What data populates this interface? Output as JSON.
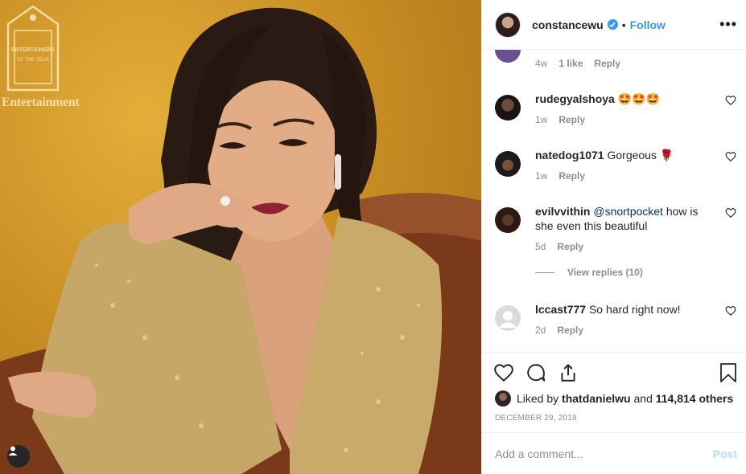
{
  "photo": {
    "brand": "Entertainment",
    "badge_text": "ENTERTAINERS OF THE YEAR",
    "tag_icon": "user-tag-icon"
  },
  "header": {
    "username": "constancewu",
    "verified_icon": "verified-badge-icon",
    "separator": "•",
    "follow_label": "Follow",
    "more_label": "•••"
  },
  "partial_comment": {
    "time": "4w",
    "likes": "1 like",
    "reply_label": "Reply"
  },
  "comments": [
    {
      "username": "rudegyalshoya",
      "text": "🤩🤩🤩",
      "time": "1w",
      "reply_label": "Reply"
    },
    {
      "username": "natedog1071",
      "text": "Gorgeous 🌹",
      "time": "1w",
      "reply_label": "Reply"
    },
    {
      "username": "evilvvithin",
      "mention": "@snortpocket",
      "text": " how is she even this beautiful",
      "time": "5d",
      "reply_label": "Reply"
    },
    {
      "username": "lccast777",
      "text": "So hard right now!",
      "time": "2d",
      "reply_label": "Reply"
    }
  ],
  "view_replies_label": "View replies (10)",
  "actions": {
    "like_icon": "heart-icon",
    "comment_icon": "comment-icon",
    "share_icon": "share-icon",
    "save_icon": "bookmark-icon"
  },
  "likes": {
    "prefix": "Liked by ",
    "user": "thatdanielwu",
    "middle": " and ",
    "count": "114,814 others"
  },
  "date": "DECEMBER 29, 2018",
  "add_comment": {
    "placeholder": "Add a comment...",
    "post_label": "Post"
  },
  "colors": {
    "accent": "#3897f0",
    "post_disabled": "#b3dbff",
    "muted": "#8e8e8e"
  }
}
